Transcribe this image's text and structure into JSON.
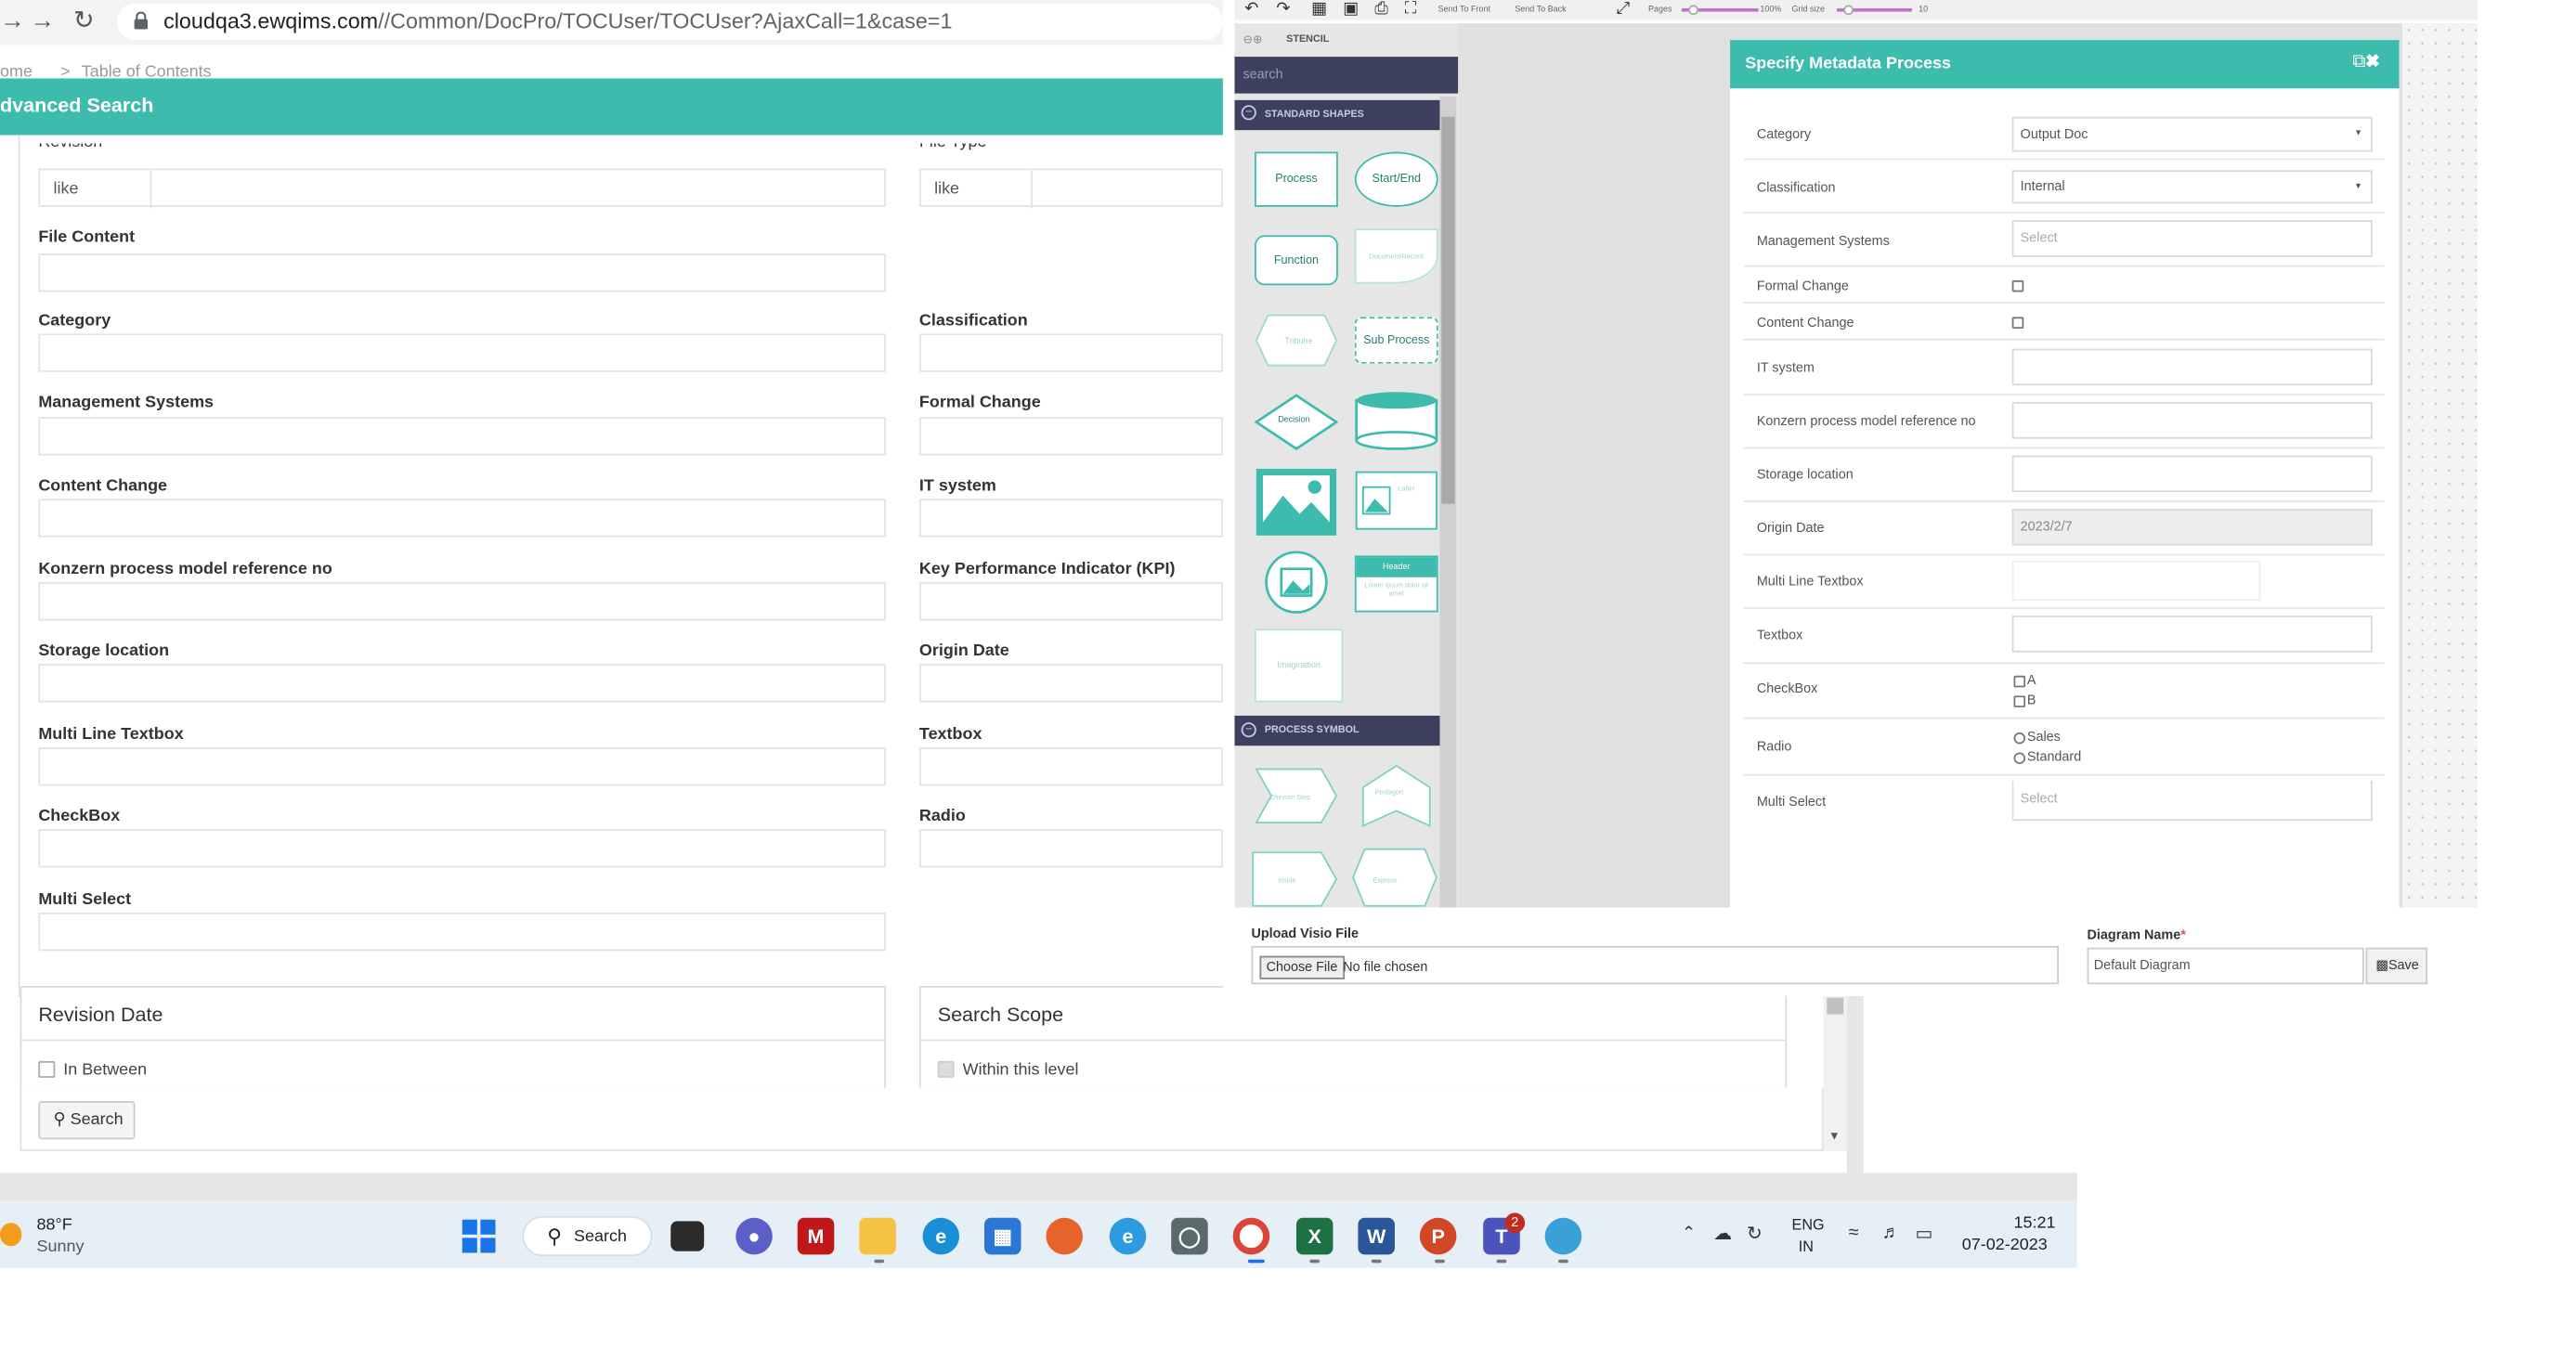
{
  "browser": {
    "url_host": "cloudqa3.ewqims.com",
    "url_path": "//Common/DocPro/TOCUser/TOCUser?AjaxCall=1&case=1",
    "breadcrumb_home": "ome",
    "breadcrumb_sep": ">",
    "breadcrumb_current": "Table of Contents"
  },
  "advanced_search": {
    "title": "dvanced Search",
    "cut_label_left": "Revision",
    "cut_label_right": "File Type",
    "like_left": "like",
    "like_right": "like",
    "left_fields": [
      "File Content",
      "Category",
      "Management Systems",
      "Content Change",
      "Konzern process model reference no",
      "Storage location",
      "Multi Line Textbox",
      "CheckBox",
      "Multi Select"
    ],
    "right_fields": [
      "Classification",
      "Formal Change",
      "IT system",
      "Key Performance Indicator (KPI)",
      "Origin Date",
      "Textbox",
      "Radio"
    ],
    "revision_date": {
      "heading": "Revision Date",
      "option": "In Between"
    },
    "search_scope": {
      "heading": "Search Scope",
      "option": "Within this level"
    },
    "search_button": "Search"
  },
  "editor_toolbar": {
    "send_to_front": "Send To Front",
    "send_to_back": "Send To Back",
    "pages_label": "Pages",
    "zoom_value": "100%",
    "grid_size_label": "Grid size",
    "grid_size_value": "10"
  },
  "stencil": {
    "header": "STENCIL",
    "search_placeholder": "search",
    "cat_standard": "STANDARD SHAPES",
    "cat_process": "PROCESS SYMBOL",
    "shapes": [
      "Process",
      "Start/End",
      "Function",
      "Document/Record",
      "Tribune",
      "Sub Process",
      "Decision",
      "Database",
      "Image",
      "Label",
      "Picture",
      "Header",
      "Lorem ipsum dolor sit amet",
      "Imagination"
    ],
    "process_shapes": [
      "Chevron Step",
      "Pentagon",
      "Inside",
      "Express"
    ]
  },
  "metadata_dialog": {
    "title": "Specify Metadata Process",
    "rows": [
      {
        "label": "Category",
        "value": "Output Doc",
        "kind": "select"
      },
      {
        "label": "Classification",
        "value": "Internal",
        "kind": "select"
      },
      {
        "label": "Management Systems",
        "value": "Select",
        "kind": "placeholder"
      },
      {
        "label": "Formal Change",
        "value": "",
        "kind": "checkbox"
      },
      {
        "label": "Content Change",
        "value": "",
        "kind": "checkbox"
      },
      {
        "label": "IT system",
        "value": "",
        "kind": "text"
      },
      {
        "label": "Konzern process model reference no",
        "value": "",
        "kind": "text"
      },
      {
        "label": "Storage location",
        "value": "",
        "kind": "text"
      },
      {
        "label": "Origin Date",
        "value": "2023/2/7",
        "kind": "readonly"
      },
      {
        "label": "Multi Line Textbox",
        "value": "",
        "kind": "textarea"
      },
      {
        "label": "Textbox",
        "value": "",
        "kind": "text"
      },
      {
        "label": "CheckBox",
        "options": [
          "A",
          "B"
        ],
        "kind": "checkgroup"
      },
      {
        "label": "Radio",
        "options": [
          "Sales",
          "Standard"
        ],
        "kind": "radiogroup"
      },
      {
        "label": "Multi Select",
        "value": "Select",
        "kind": "placeholder"
      }
    ]
  },
  "upload": {
    "visio_label": "Upload Visio File",
    "choose_button": "Choose File",
    "no_file": "No file chosen",
    "diagram_name_label": "Diagram Name",
    "required_mark": "*",
    "diagram_name_value": "Default Diagram",
    "save_button": "Save"
  },
  "taskbar": {
    "weather_temp": "88°F",
    "weather_desc": "Sunny",
    "search_label": "Search",
    "lang_top": "ENG",
    "lang_bottom": "IN",
    "time": "15:21",
    "date": "07-02-2023",
    "teams_badge": "2",
    "apps": [
      "task-view",
      "chat",
      "mcafee",
      "file-explorer",
      "edge",
      "store",
      "firefox",
      "edge-beta",
      "vpn",
      "chrome",
      "excel",
      "word",
      "powerpoint",
      "teams",
      "app"
    ]
  },
  "colors": {
    "teal": "#3dbbad",
    "stencil_dark": "#3c3f5e",
    "taskbar": "#e6eef6"
  }
}
